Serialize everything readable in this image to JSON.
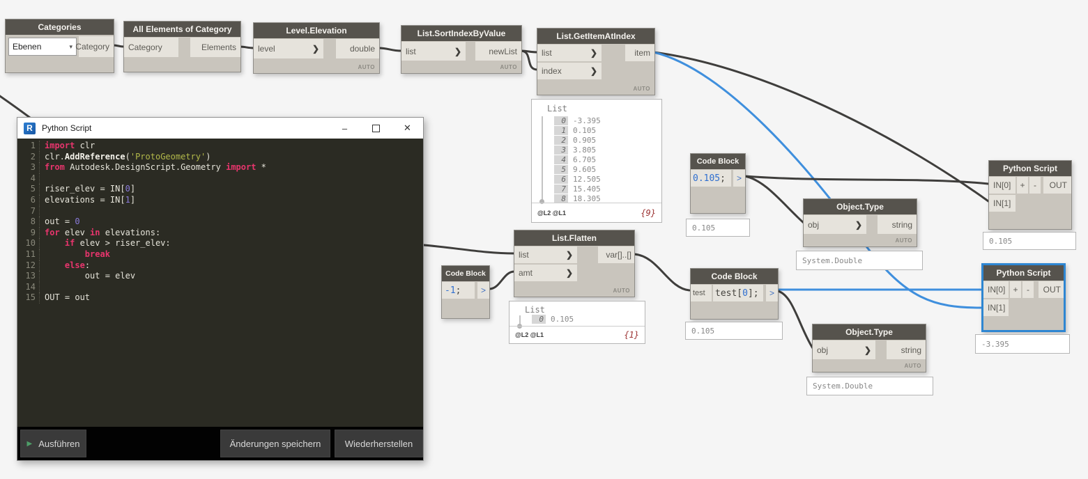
{
  "colors": {
    "wire": "#3f3e3c",
    "wire_selected": "#3f8fdd",
    "node_header": "#56534d",
    "selection": "#2e86d2",
    "canvas": "#f5f5f5"
  },
  "nodes": {
    "categories": {
      "title": "Categories",
      "dropdown_value": "Ebenen",
      "out": "Category"
    },
    "all_elements": {
      "title": "All Elements of Category",
      "in1": "Category",
      "out": "Elements"
    },
    "level_elevation": {
      "title": "Level.Elevation",
      "in1": "level",
      "out": "double",
      "lacing": "AUTO"
    },
    "sort_index": {
      "title": "List.SortIndexByValue",
      "in1": "list",
      "out": "newList",
      "lacing": "AUTO"
    },
    "get_item": {
      "title": "List.GetItemAtIndex",
      "in1": "list",
      "in2": "index",
      "out": "item",
      "lacing": "AUTO"
    },
    "code_block_riser": {
      "title": "Code Block",
      "out_port": ">",
      "segments": [
        [
          "num",
          "0.105"
        ],
        [
          "pl",
          ";"
        ]
      ],
      "watch": "0.105"
    },
    "code_block_neg1": {
      "title": "Code Block",
      "out_port": ">",
      "segments": [
        [
          "num",
          "-1"
        ],
        [
          "pl",
          ";"
        ]
      ]
    },
    "list_flatten": {
      "title": "List.Flatten",
      "in1": "list",
      "in2": "amt",
      "out": "var[]..[]",
      "lacing": "AUTO"
    },
    "code_block_test": {
      "title": "Code Block",
      "in1": "test",
      "out_port": ">",
      "segments": [
        [
          "pl",
          "test["
        ],
        [
          "num",
          "0"
        ],
        [
          "pl",
          "];"
        ]
      ],
      "watch": "0.105"
    },
    "object_type_top": {
      "title": "Object.Type",
      "in1": "obj",
      "out": "string",
      "lacing": "AUTO",
      "watch": "System.Double"
    },
    "object_type_bottom": {
      "title": "Object.Type",
      "in1": "obj",
      "out": "string",
      "lacing": "AUTO",
      "watch": "System.Double"
    },
    "python_top": {
      "title": "Python Script",
      "in1": "IN[0]",
      "in2": "IN[1]",
      "plus": "+",
      "minus": "-",
      "out": "OUT",
      "watch": "0.105"
    },
    "python_bottom": {
      "title": "Python Script",
      "in1": "IN[0]",
      "in2": "IN[1]",
      "plus": "+",
      "minus": "-",
      "out": "OUT",
      "watch": "-3.395"
    }
  },
  "watch_sorted": {
    "label": "List",
    "items": [
      [
        "0",
        "-3.395"
      ],
      [
        "1",
        "0.105"
      ],
      [
        "2",
        "0.905"
      ],
      [
        "3",
        "3.805"
      ],
      [
        "4",
        "6.705"
      ],
      [
        "5",
        "9.605"
      ],
      [
        "6",
        "12.505"
      ],
      [
        "7",
        "15.405"
      ],
      [
        "8",
        "18.305"
      ]
    ],
    "levels": "@L2 @L1",
    "count": "{9}"
  },
  "watch_flatten": {
    "label": "List",
    "items": [
      [
        "0",
        "0.105"
      ]
    ],
    "levels": "@L2 @L1",
    "count": "{1}"
  },
  "editor": {
    "title": "Python Script",
    "controls": {
      "minimize": "–",
      "close": "✕"
    },
    "code": [
      [
        [
          "kw",
          "import"
        ],
        [
          "pl",
          " clr"
        ]
      ],
      [
        [
          "pl",
          "clr."
        ],
        [
          "fn",
          "AddReference"
        ],
        [
          "pl",
          "("
        ],
        [
          "str",
          "'ProtoGeometry'"
        ],
        [
          "pl",
          ")"
        ]
      ],
      [
        [
          "kw",
          "from"
        ],
        [
          "pl",
          " Autodesk.DesignScript.Geometry "
        ],
        [
          "kw",
          "import"
        ],
        [
          "pl",
          " *"
        ]
      ],
      [],
      [
        [
          "pl",
          "riser_elev = IN["
        ],
        [
          "num",
          "0"
        ],
        [
          "pl",
          "]"
        ]
      ],
      [
        [
          "pl",
          "elevations = IN["
        ],
        [
          "num",
          "1"
        ],
        [
          "pl",
          "]"
        ]
      ],
      [],
      [
        [
          "pl",
          "out = "
        ],
        [
          "num",
          "0"
        ]
      ],
      [
        [
          "kw",
          "for"
        ],
        [
          "pl",
          " elev "
        ],
        [
          "kw",
          "in"
        ],
        [
          "pl",
          " elevations:"
        ]
      ],
      [
        [
          "pl",
          "    "
        ],
        [
          "kw",
          "if"
        ],
        [
          "pl",
          " elev > riser_elev:"
        ]
      ],
      [
        [
          "pl",
          "        "
        ],
        [
          "kw",
          "break"
        ]
      ],
      [
        [
          "pl",
          "    "
        ],
        [
          "kw",
          "else"
        ],
        [
          "pl",
          ":"
        ]
      ],
      [
        [
          "pl",
          "        out = elev"
        ]
      ],
      [],
      [
        [
          "pl",
          "OUT = out"
        ]
      ]
    ],
    "buttons": {
      "run": "Ausführen",
      "save": "Änderungen speichern",
      "restore": "Wiederherstellen"
    }
  }
}
